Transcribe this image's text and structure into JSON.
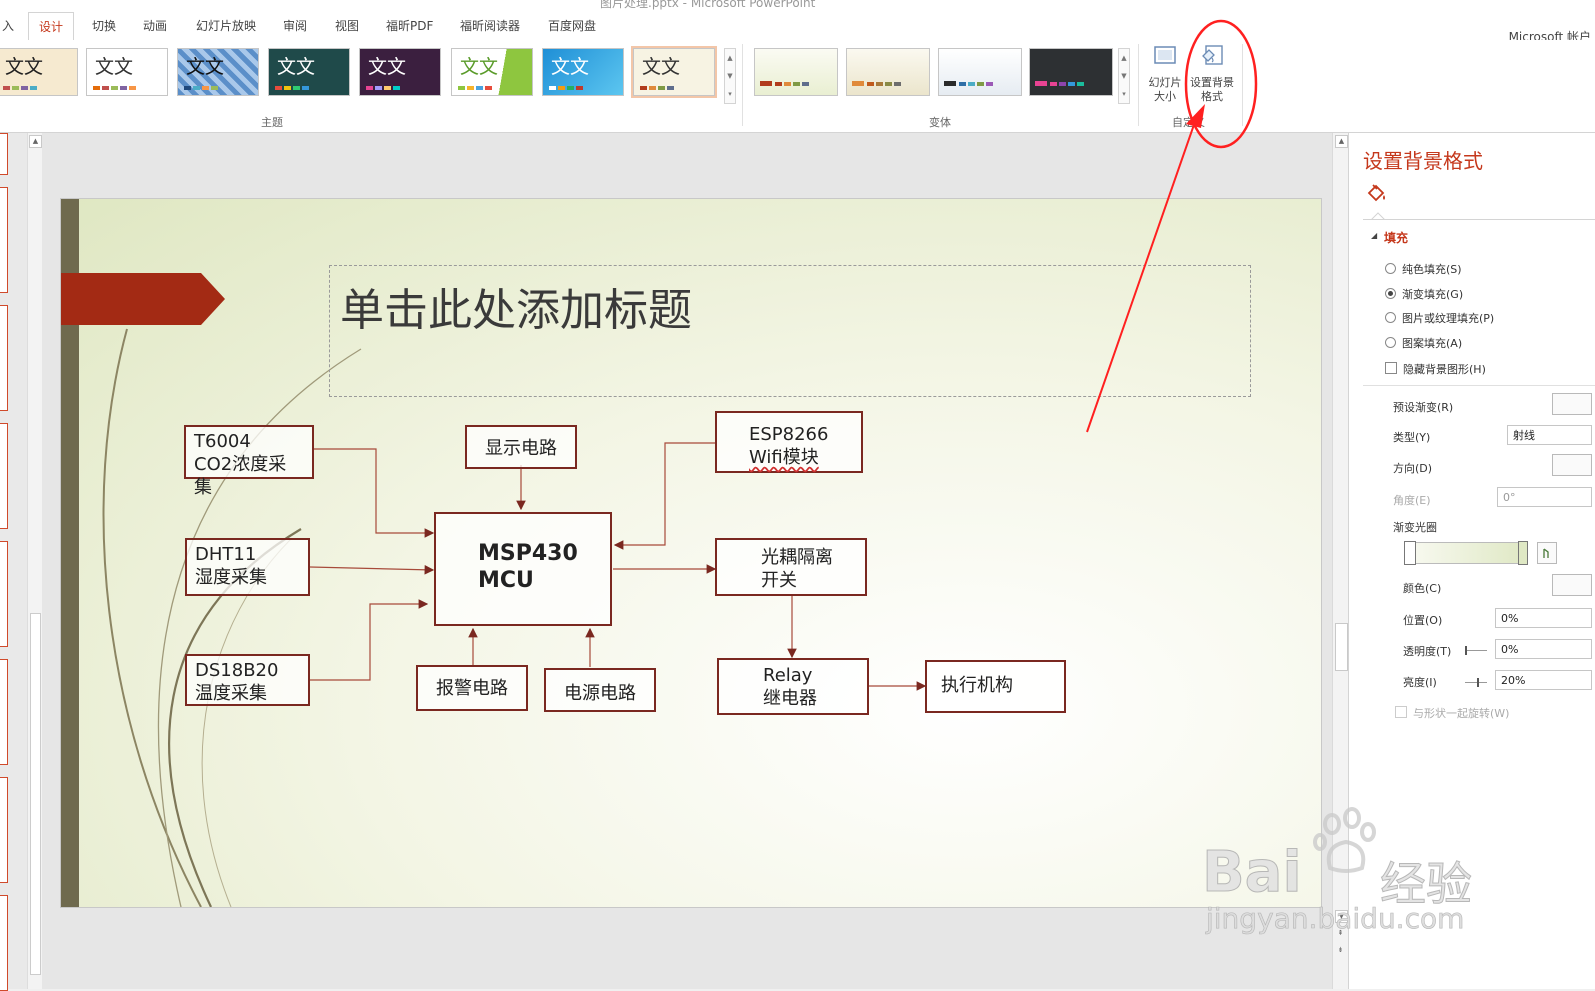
{
  "window": {
    "title": "图片处理.pptx - Microsoft PowerPoint",
    "account": "Microsoft 帐户"
  },
  "tabs": [
    {
      "label": "入"
    },
    {
      "label": "设计"
    },
    {
      "label": "切换"
    },
    {
      "label": "动画"
    },
    {
      "label": "幻灯片放映"
    },
    {
      "label": "审阅"
    },
    {
      "label": "视图"
    },
    {
      "label": "福昕PDF"
    },
    {
      "label": "福昕阅读器"
    },
    {
      "label": "百度网盘"
    }
  ],
  "ribbon": {
    "themes_label": "主题",
    "variants_label": "变体",
    "customize_label": "自定义",
    "theme_text": "文文",
    "slide_size_label": "幻灯片大小",
    "format_bg_label": "设置背景格式"
  },
  "slide": {
    "title_placeholder": "单击此处添加标题",
    "boxes": {
      "t6004": {
        "line1": "T6004",
        "line2": "CO2浓度采",
        "line3": "集"
      },
      "dht11": {
        "line1": "DHT11",
        "line2": "湿度采集"
      },
      "ds18b20": {
        "line1": "DS18B20",
        "line2": "温度采集"
      },
      "display": {
        "line1": "显示电路"
      },
      "mcu": {
        "line1": "MSP430",
        "line2": "MCU"
      },
      "alarm": {
        "line1": "报警电路"
      },
      "power": {
        "line1": "电源电路"
      },
      "esp8266": {
        "line1": "ESP8266",
        "line2": "Wifi模块"
      },
      "optocoupler": {
        "line1": "光耦隔离",
        "line2": "开关"
      },
      "relay": {
        "line1": "Relay",
        "line2": "继电器"
      },
      "actuator": {
        "line1": "执行机构"
      }
    }
  },
  "pane": {
    "title": "设置背景格式",
    "section": "填充",
    "fill_options": [
      {
        "label": "纯色填充(S)",
        "selected": false
      },
      {
        "label": "渐变填充(G)",
        "selected": true
      },
      {
        "label": "图片或纹理填充(P)",
        "selected": false
      },
      {
        "label": "图案填充(A)",
        "selected": false
      }
    ],
    "hide_bg_graphics": "隐藏背景图形(H)",
    "preset_gradient": "预设渐变(R)",
    "type_label": "类型(Y)",
    "type_value": "射线",
    "direction_label": "方向(D)",
    "angle_label": "角度(E)",
    "angle_value": "0°",
    "gradient_stops": "渐变光圈",
    "color_label": "颜色(C)",
    "position_label": "位置(O)",
    "position_value": "0%",
    "transparency_label": "透明度(T)",
    "transparency_value": "0%",
    "brightness_label": "亮度(I)",
    "brightness_value": "20%",
    "rotate_with_shape": "与形状一起旋转(W)"
  },
  "watermark": {
    "brand": "Bai",
    "brand2": "经验",
    "url": "jingyan.baidu.com"
  },
  "colors": {
    "accent": "#c5381c",
    "diagram_line": "#7a2820",
    "slide_band": "#6f6a4e",
    "annotation": "#ff2020"
  }
}
